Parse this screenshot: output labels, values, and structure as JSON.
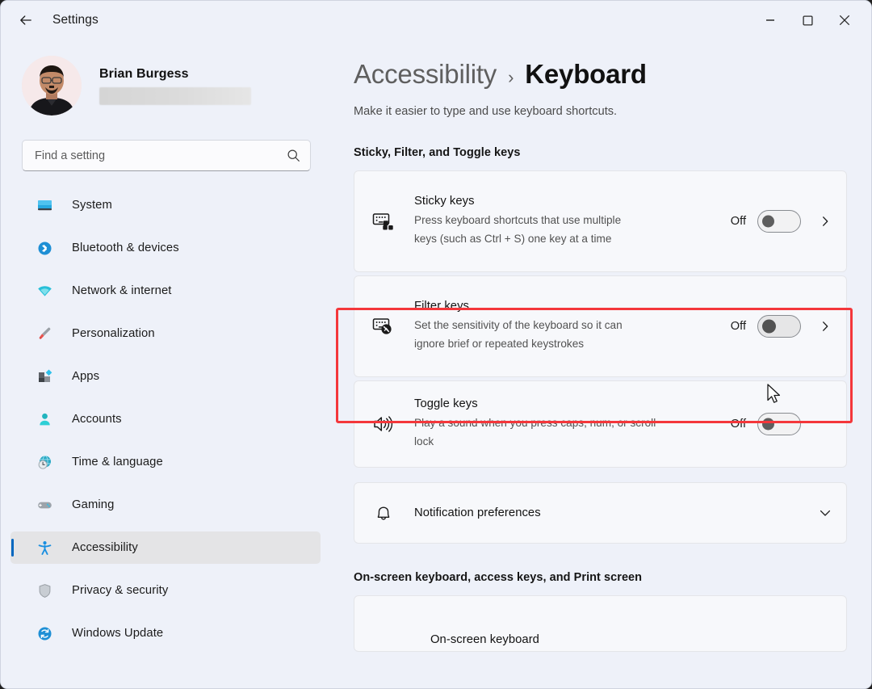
{
  "window": {
    "app_title": "Settings",
    "back_icon": "back-arrow-icon",
    "controls": {
      "minimize": "minimize-icon",
      "maximize": "maximize-icon",
      "close": "close-icon"
    }
  },
  "sidebar": {
    "profile": {
      "name": "Brian Burgess",
      "email_redacted": ""
    },
    "search": {
      "placeholder": "Find a setting",
      "value": "",
      "icon": "search-icon"
    },
    "items": [
      {
        "label": "System",
        "icon": "monitor-icon",
        "selected": false
      },
      {
        "label": "Bluetooth & devices",
        "icon": "bluetooth-icon",
        "selected": false
      },
      {
        "label": "Network & internet",
        "icon": "wifi-icon",
        "selected": false
      },
      {
        "label": "Personalization",
        "icon": "paintbrush-icon",
        "selected": false
      },
      {
        "label": "Apps",
        "icon": "apps-icon",
        "selected": false
      },
      {
        "label": "Accounts",
        "icon": "person-icon",
        "selected": false
      },
      {
        "label": "Time & language",
        "icon": "clock-globe-icon",
        "selected": false
      },
      {
        "label": "Gaming",
        "icon": "gamepad-icon",
        "selected": false
      },
      {
        "label": "Accessibility",
        "icon": "accessibility-person-icon",
        "selected": true
      },
      {
        "label": "Privacy & security",
        "icon": "shield-icon",
        "selected": false
      },
      {
        "label": "Windows Update",
        "icon": "update-refresh-icon",
        "selected": false
      }
    ]
  },
  "main": {
    "breadcrumb": {
      "parent": "Accessibility",
      "separator": "›",
      "current": "Keyboard"
    },
    "subtitle": "Make it easier to type and use keyboard shortcuts.",
    "sections": [
      {
        "heading": "Sticky, Filter, and Toggle keys",
        "cards": [
          {
            "title": "Sticky keys",
            "description": "Press keyboard shortcuts that use multiple keys (such as Ctrl + S) one key at a time",
            "icon": "sticky-keys-keyboard-icon",
            "toggle_state": "Off",
            "toggle_on": false,
            "has_chevron": true,
            "highlighted": false
          },
          {
            "title": "Filter keys",
            "description": "Set the sensitivity of the keyboard so it can ignore brief or repeated keystrokes",
            "icon": "filter-keys-keyboard-icon",
            "toggle_state": "Off",
            "toggle_on": false,
            "has_chevron": true,
            "highlighted": true
          },
          {
            "title": "Toggle keys",
            "description": "Play a sound when you press caps, num, or scroll lock",
            "icon": "speaker-sound-icon",
            "toggle_state": "Off",
            "toggle_on": false,
            "has_chevron": false,
            "highlighted": false
          }
        ]
      }
    ],
    "notification_card": {
      "title": "Notification preferences",
      "icon": "bell-icon",
      "expand_icon": "chevron-down-icon"
    },
    "bottom_section": {
      "heading": "On-screen keyboard, access keys, and Print screen",
      "first_card_title": "On-screen keyboard"
    }
  },
  "annotation": {
    "highlight_color": "#f4373b",
    "target": "Filter keys"
  },
  "cursor": {
    "icon": "mouse-pointer-icon"
  }
}
